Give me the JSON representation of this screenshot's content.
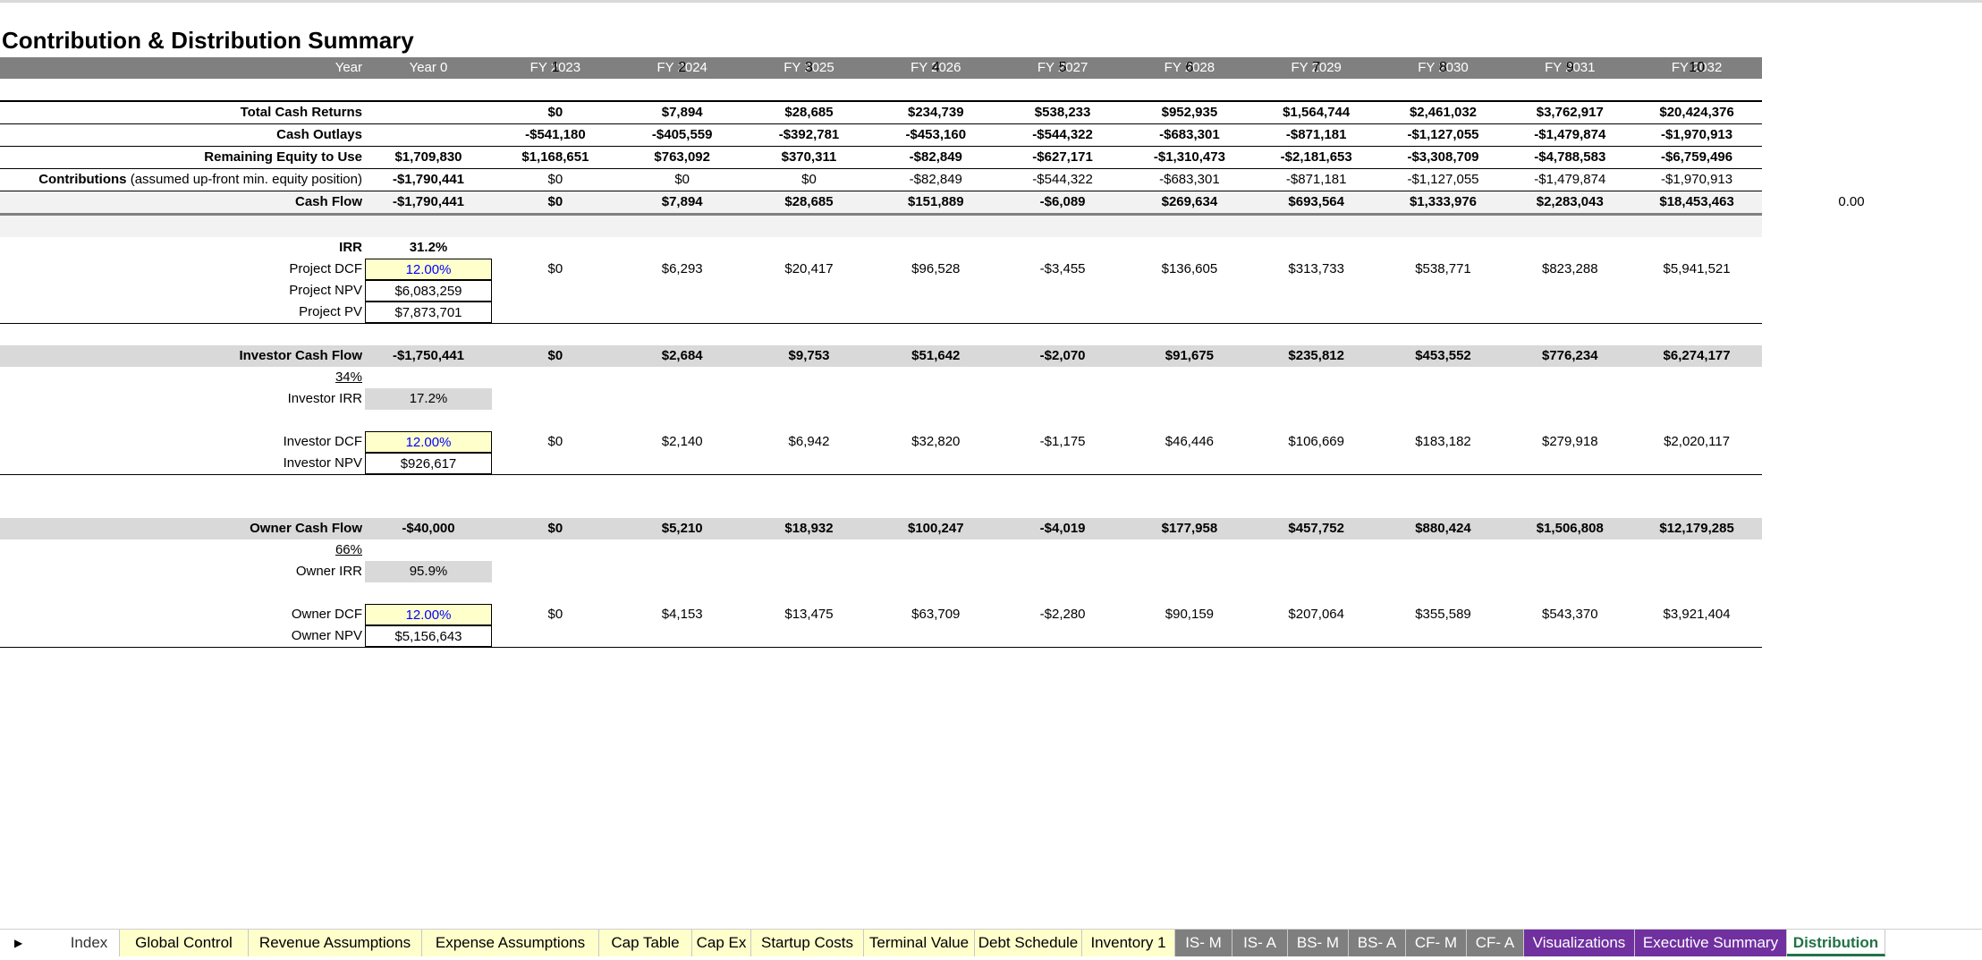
{
  "sheet_title": "Contribution & Distribution Summary",
  "period_numbers": [
    "1",
    "2",
    "3",
    "4",
    "5",
    "6",
    "7",
    "8",
    "9",
    "10"
  ],
  "header": {
    "year_label": "Year",
    "year0": "Year 0",
    "years": [
      "FY 2023",
      "FY 2024",
      "FY 2025",
      "FY 2026",
      "FY 2027",
      "FY 2028",
      "FY 2029",
      "FY 2030",
      "FY 2031",
      "FY 2032"
    ]
  },
  "total_cash_returns": {
    "label": "Total Cash Returns",
    "year0": "",
    "values": [
      "$0",
      "$7,894",
      "$28,685",
      "$234,739",
      "$538,233",
      "$952,935",
      "$1,564,744",
      "$2,461,032",
      "$3,762,917",
      "$20,424,376"
    ]
  },
  "cash_outlays": {
    "label": "Cash Outlays",
    "year0": "",
    "values": [
      "-$541,180",
      "-$405,559",
      "-$392,781",
      "-$453,160",
      "-$544,322",
      "-$683,301",
      "-$871,181",
      "-$1,127,055",
      "-$1,479,874",
      "-$1,970,913"
    ]
  },
  "remaining_equity": {
    "label": "Remaining Equity to Use",
    "year0": "$1,709,830",
    "values": [
      "$1,168,651",
      "$763,092",
      "$370,311",
      "-$82,849",
      "-$627,171",
      "-$1,310,473",
      "-$2,181,653",
      "-$3,308,709",
      "-$4,788,583",
      "-$6,759,496"
    ]
  },
  "contributions": {
    "label_bold": "Contributions",
    "label_note": "(assumed up-front min. equity position)",
    "year0": "-$1,790,441",
    "values": [
      "$0",
      "$0",
      "$0",
      "-$82,849",
      "-$544,322",
      "-$683,301",
      "-$871,181",
      "-$1,127,055",
      "-$1,479,874",
      "-$1,970,913"
    ]
  },
  "cash_flow": {
    "label": "Cash Flow",
    "year0": "-$1,790,441",
    "values": [
      "$0",
      "$7,894",
      "$28,685",
      "$151,889",
      "-$6,089",
      "$269,634",
      "$693,564",
      "$1,333,976",
      "$2,283,043",
      "$18,453,463"
    ],
    "extra": "0.00"
  },
  "project": {
    "irr_label": "IRR",
    "irr": "31.2%",
    "dcf_label": "Project DCF",
    "dcf_rate": "12.00%",
    "dcf_values": [
      "$0",
      "$6,293",
      "$20,417",
      "$96,528",
      "-$3,455",
      "$136,605",
      "$313,733",
      "$538,771",
      "$823,288",
      "$5,941,521"
    ],
    "npv_label": "Project NPV",
    "npv": "$6,083,259",
    "pv_label": "Project PV",
    "pv": "$7,873,701"
  },
  "investor": {
    "cf_label": "Investor Cash Flow",
    "year0": "-$1,750,441",
    "cf_values": [
      "$0",
      "$2,684",
      "$9,753",
      "$51,642",
      "-$2,070",
      "$91,675",
      "$235,812",
      "$453,552",
      "$776,234",
      "$6,274,177"
    ],
    "share": "34%",
    "irr_label": "Investor IRR",
    "irr": "17.2%",
    "dcf_label": "Investor DCF",
    "dcf_rate": "12.00%",
    "dcf_values": [
      "$0",
      "$2,140",
      "$6,942",
      "$32,820",
      "-$1,175",
      "$46,446",
      "$106,669",
      "$183,182",
      "$279,918",
      "$2,020,117"
    ],
    "npv_label": "Investor NPV",
    "npv": "$926,617"
  },
  "owner": {
    "cf_label": "Owner Cash Flow",
    "year0": "-$40,000",
    "cf_values": [
      "$0",
      "$5,210",
      "$18,932",
      "$100,247",
      "-$4,019",
      "$177,958",
      "$457,752",
      "$880,424",
      "$1,506,808",
      "$12,179,285"
    ],
    "share": "66%",
    "irr_label": "Owner IRR",
    "irr": "95.9%",
    "dcf_label": "Owner DCF",
    "dcf_rate": "12.00%",
    "dcf_values": [
      "$0",
      "$4,153",
      "$13,475",
      "$63,709",
      "-$2,280",
      "$90,159",
      "$207,064",
      "$355,589",
      "$543,370",
      "$3,921,404"
    ],
    "npv_label": "Owner NPV",
    "npv": "$5,156,643"
  },
  "tabs": [
    {
      "label": "Index",
      "style": "white"
    },
    {
      "label": "Global Control",
      "style": "yellow"
    },
    {
      "label": "Revenue Assumptions",
      "style": "yellow"
    },
    {
      "label": "Expense Assumptions",
      "style": "yellow"
    },
    {
      "label": "Cap Table",
      "style": "yellow"
    },
    {
      "label": "Cap Ex",
      "style": "yellow"
    },
    {
      "label": "Startup Costs",
      "style": "yellow"
    },
    {
      "label": "Terminal Value",
      "style": "yellow"
    },
    {
      "label": "Debt Schedule",
      "style": "yellow"
    },
    {
      "label": "Inventory 1",
      "style": "yellow"
    },
    {
      "label": "IS- M",
      "style": "gray"
    },
    {
      "label": "IS- A",
      "style": "gray"
    },
    {
      "label": "BS- M",
      "style": "gray"
    },
    {
      "label": "BS- A",
      "style": "gray"
    },
    {
      "label": "CF- M",
      "style": "gray"
    },
    {
      "label": "CF- A",
      "style": "gray"
    },
    {
      "label": "Visualizations",
      "style": "purple"
    },
    {
      "label": "Executive Summary",
      "style": "purple"
    },
    {
      "label": "Distribution",
      "style": "active"
    }
  ]
}
